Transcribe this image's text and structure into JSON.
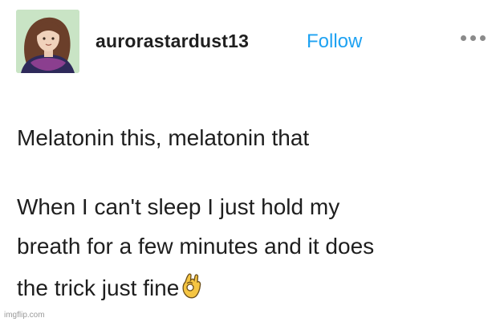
{
  "post": {
    "username": "aurorastardust13",
    "follow_label": "Follow",
    "lines": [
      "Melatonin this, melatonin that",
      "When I can't sleep I just hold my",
      "breath for a few minutes and it does",
      "the trick just fine"
    ],
    "emoji": "ok-hand-emoji"
  },
  "watermark": "imgflip.com",
  "colors": {
    "follow": "#1ea2f2",
    "text": "#1e1e1e",
    "dots": "#8a8a8a"
  },
  "icons": [
    "avatar-image",
    "more-options-icon",
    "ok-hand-emoji"
  ]
}
